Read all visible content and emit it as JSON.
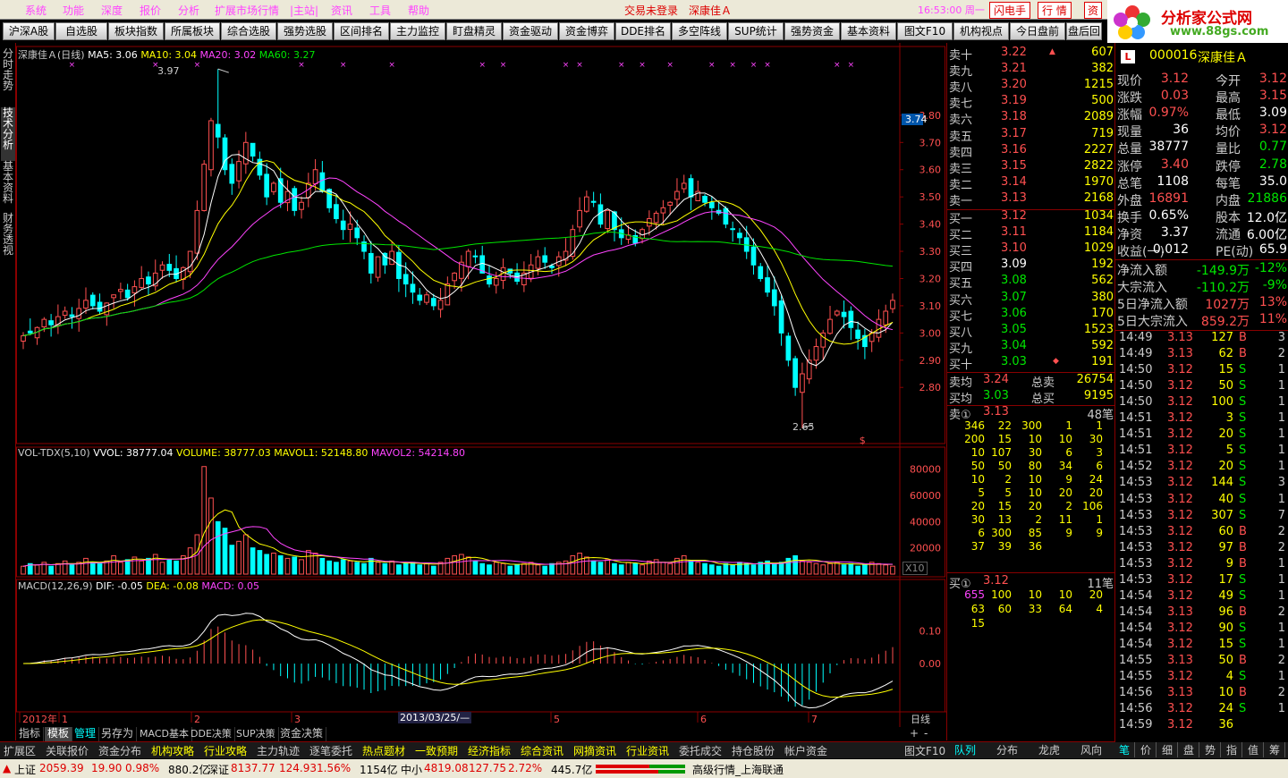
{
  "menu": {
    "items": [
      "系统",
      "功能",
      "深度",
      "报价",
      "分析",
      "扩展市场行情",
      "|主站|",
      "资讯",
      "工具",
      "帮助"
    ],
    "login_status": "交易未登录",
    "stock_title": "深康佳Ａ",
    "clock": "16:53:00 周一",
    "buttons": [
      "闪电手",
      "行 情",
      "资"
    ]
  },
  "logo": {
    "title": "分析家公式网",
    "url": "www.88gs.com"
  },
  "toolbar": [
    "沪深A股",
    "自选股",
    "板块指数",
    "所属板块",
    "综合选股",
    "强势选股",
    "区间排名",
    "主力监控",
    "盯盘精灵",
    "资金驱动",
    "资金博弈",
    "DDE排名",
    "多空阵线",
    "SUP统计",
    "强势资金",
    "基本资料",
    "图文F10",
    "机构视点",
    "今日盘前",
    "盘后回"
  ],
  "left_tabs": [
    "分时走势",
    "技术分析",
    "基本资料",
    "财务透视"
  ],
  "chart_legend": {
    "stock": "深康佳Ａ(日线)",
    "ma5": "MA5: 3.06",
    "ma10": "MA10: 3.04",
    "ma20": "MA20: 3.02",
    "ma60": "MA60: 3.27",
    "vol_title": "VOL-TDX(5,10)",
    "vvol": "VVOL: 38777.04",
    "volume": "VOLUME: 38777.03",
    "mavol1": "MAVOL1: 52148.80",
    "mavol2": "MAVOL2: 54214.80",
    "macd_title": "MACD(12,26,9)",
    "dif": "DIF: -0.05",
    "dea": "DEA: -0.08",
    "macd": "MACD: 0.05",
    "x10": "X10",
    "period": "日线",
    "high_label": "3.97",
    "low_label": "2.65",
    "current_price_tag": "3.74",
    "date_cursor": "2013/03/25/—"
  },
  "chart_data": [
    {
      "type": "candlestick",
      "title": "深康佳Ａ(日线)",
      "y_ticks": [
        2.8,
        2.9,
        3.0,
        3.1,
        3.2,
        3.3,
        3.4,
        3.5,
        3.6,
        3.7,
        3.8
      ],
      "ylim": [
        2.62,
        4.0
      ],
      "x_tick_labels": [
        "2012年",
        "1",
        "2",
        "3",
        "5",
        "6",
        "7"
      ],
      "highest": 3.97,
      "lowest": 2.65,
      "ma_lines": [
        {
          "name": "MA5",
          "color": "#ffffff"
        },
        {
          "name": "MA10",
          "color": "#ffff00"
        },
        {
          "name": "MA20",
          "color": "#ff44ff"
        },
        {
          "name": "MA60",
          "color": "#00e600"
        }
      ],
      "close_series": [
        2.99,
        3.0,
        3.02,
        3.05,
        3.03,
        3.06,
        3.08,
        3.06,
        3.09,
        3.12,
        3.1,
        3.08,
        3.11,
        3.14,
        3.16,
        3.13,
        3.17,
        3.2,
        3.18,
        3.22,
        3.25,
        3.23,
        3.2,
        3.24,
        3.3,
        3.45,
        3.62,
        3.78,
        3.72,
        3.6,
        3.55,
        3.63,
        3.7,
        3.65,
        3.58,
        3.5,
        3.55,
        3.48,
        3.52,
        3.45,
        3.48,
        3.55,
        3.6,
        3.52,
        3.46,
        3.42,
        3.38,
        3.4,
        3.35,
        3.3,
        3.22,
        3.28,
        3.25,
        3.3,
        3.2,
        3.18,
        3.15,
        3.12,
        3.14,
        3.1,
        3.12,
        3.18,
        3.22,
        3.26,
        3.3,
        3.28,
        3.22,
        3.18,
        3.2,
        3.24,
        3.22,
        3.19,
        3.22,
        3.25,
        3.28,
        3.26,
        3.24,
        3.28,
        3.3,
        3.38,
        3.45,
        3.5,
        3.48,
        3.4,
        3.45,
        3.38,
        3.35,
        3.36,
        3.33,
        3.38,
        3.42,
        3.44,
        3.46,
        3.48,
        3.52,
        3.55,
        3.5,
        3.52,
        3.48,
        3.46,
        3.44,
        3.4,
        3.38,
        3.35,
        3.3,
        3.25,
        3.2,
        3.15,
        3.1,
        3.0,
        2.9,
        2.8,
        2.85,
        2.9,
        2.95,
        3.0,
        3.05,
        3.08,
        3.06,
        3.02,
        2.98,
        2.95,
        3.0,
        3.05,
        3.08,
        3.12
      ],
      "volume_ticks": [
        20000,
        40000,
        60000,
        80000
      ],
      "volume_ylim": [
        0,
        90000
      ],
      "volume_series": [
        6000,
        8000,
        7000,
        9000,
        6000,
        8000,
        10000,
        7000,
        9000,
        12000,
        9000,
        8000,
        10000,
        14000,
        9000,
        11000,
        13000,
        10000,
        12000,
        15000,
        9000,
        11000,
        10000,
        14000,
        20000,
        30000,
        82000,
        58000,
        40000,
        35000,
        22000,
        25000,
        30000,
        20000,
        18000,
        15000,
        16000,
        14000,
        12000,
        13000,
        11000,
        18000,
        16000,
        12000,
        10000,
        9000,
        11000,
        10000,
        9000,
        8000,
        12000,
        9000,
        8000,
        10000,
        7000,
        8000,
        9000,
        7000,
        8000,
        6000,
        9000,
        12000,
        14000,
        15000,
        13000,
        10000,
        8000,
        7000,
        9000,
        8000,
        6000,
        7000,
        8000,
        9000,
        7000,
        6000,
        8000,
        9000,
        10000,
        14000,
        16000,
        13000,
        10000,
        9000,
        11000,
        8000,
        7000,
        9000,
        8000,
        7000,
        10000,
        11000,
        9000,
        8000,
        12000,
        14000,
        10000,
        9000,
        8000,
        7000,
        6000,
        8000,
        7000,
        9000,
        8000,
        7000,
        9000,
        10000,
        8000,
        9000,
        12000,
        14000,
        10000,
        9000,
        8000,
        7000,
        8000,
        9000,
        7000,
        8000,
        6000,
        7000,
        9000,
        8000,
        7000,
        6000
      ],
      "macd_ticks": [
        0.0,
        0.1
      ],
      "macd_ylim": [
        -0.14,
        0.22
      ]
    }
  ],
  "quote_panel": {
    "sell": [
      {
        "label": "卖十",
        "price": "3.22",
        "vol": "607"
      },
      {
        "label": "卖九",
        "price": "3.21",
        "vol": "382"
      },
      {
        "label": "卖八",
        "price": "3.20",
        "vol": "1215"
      },
      {
        "label": "卖七",
        "price": "3.19",
        "vol": "500"
      },
      {
        "label": "卖六",
        "price": "3.18",
        "vol": "2089"
      },
      {
        "label": "卖五",
        "price": "3.17",
        "vol": "719"
      },
      {
        "label": "卖四",
        "price": "3.16",
        "vol": "2227"
      },
      {
        "label": "卖三",
        "price": "3.15",
        "vol": "2822"
      },
      {
        "label": "卖二",
        "price": "3.14",
        "vol": "1970"
      },
      {
        "label": "卖一",
        "price": "3.13",
        "vol": "2168"
      }
    ],
    "buy": [
      {
        "label": "买一",
        "price": "3.12",
        "vol": "1034"
      },
      {
        "label": "买二",
        "price": "3.11",
        "vol": "1184"
      },
      {
        "label": "买三",
        "price": "3.10",
        "vol": "1029"
      },
      {
        "label": "买四",
        "price": "3.09",
        "vol": "192"
      },
      {
        "label": "买五",
        "price": "3.08",
        "vol": "562"
      },
      {
        "label": "买六",
        "price": "3.07",
        "vol": "380"
      },
      {
        "label": "买七",
        "price": "3.06",
        "vol": "170"
      },
      {
        "label": "买八",
        "price": "3.05",
        "vol": "1523"
      },
      {
        "label": "买九",
        "price": "3.04",
        "vol": "592"
      },
      {
        "label": "买十",
        "price": "3.03",
        "vol": "191"
      }
    ],
    "avg": [
      {
        "label": "卖均",
        "price": "3.24",
        "tl": "总卖",
        "tv": "26754"
      },
      {
        "label": "买均",
        "price": "3.03",
        "tl": "总买",
        "tv": "9195"
      }
    ],
    "sell1_queue": {
      "label": "卖①",
      "price": "3.13",
      "count": "48笔"
    },
    "sell_queue_rows": [
      [
        "346",
        "22",
        "300",
        "1",
        "1"
      ],
      [
        "200",
        "15",
        "10",
        "10",
        "30"
      ],
      [
        "10",
        "107",
        "30",
        "6",
        "3"
      ],
      [
        "50",
        "50",
        "80",
        "34",
        "6"
      ],
      [
        "10",
        "2",
        "10",
        "9",
        "24"
      ],
      [
        "5",
        "5",
        "10",
        "20",
        "20"
      ],
      [
        "20",
        "15",
        "20",
        "2",
        "106"
      ],
      [
        "30",
        "13",
        "2",
        "11",
        "1"
      ],
      [
        "6",
        "300",
        "85",
        "9",
        "9"
      ],
      [
        "37",
        "39",
        "36"
      ]
    ],
    "buy1_queue": {
      "label": "买①",
      "price": "3.12",
      "count": "11笔"
    },
    "buy_queue_rows": [
      [
        "655",
        "100",
        "10",
        "10",
        "20"
      ],
      [
        "63",
        "60",
        "33",
        "64",
        "4"
      ],
      [
        "15"
      ]
    ]
  },
  "right_panel": {
    "code": "000016",
    "name": "深康佳Ａ",
    "stats": [
      [
        "现价",
        "3.12",
        "今开",
        "3.12"
      ],
      [
        "涨跌",
        "0.03",
        "最高",
        "3.15"
      ],
      [
        "涨幅",
        "0.97%",
        "最低",
        "3.09"
      ],
      [
        "现量",
        "36",
        "均价",
        "3.12"
      ],
      [
        "总量",
        "38777",
        "量比",
        "0.77"
      ],
      [
        "涨停",
        "3.40",
        "跌停",
        "2.78"
      ],
      [
        "总笔",
        "1108",
        "每笔",
        "35.0"
      ],
      [
        "外盘",
        "16891",
        "内盘",
        "21886"
      ],
      [
        "换手",
        "0.65%",
        "股本",
        "12.0亿"
      ],
      [
        "净资",
        "3.37",
        "流通",
        "6.00亿"
      ],
      [
        "收益(一)",
        "0.012",
        "PE(动)",
        "65.9"
      ]
    ],
    "flows": [
      [
        "净流入额",
        "-149.9万",
        "-12%"
      ],
      [
        "大宗流入",
        "-110.2万",
        "-9%"
      ],
      [
        "5日净流入额",
        "1027万",
        "13%"
      ],
      [
        "5日大宗流入",
        "859.2万",
        "11%"
      ]
    ],
    "ticks": [
      [
        "14:49",
        "3.13",
        "127",
        "B",
        "3"
      ],
      [
        "14:49",
        "3.13",
        "62",
        "B",
        "2"
      ],
      [
        "14:50",
        "3.12",
        "15",
        "S",
        "1"
      ],
      [
        "14:50",
        "3.12",
        "50",
        "S",
        "1"
      ],
      [
        "14:50",
        "3.12",
        "100",
        "S",
        "1"
      ],
      [
        "14:51",
        "3.12",
        "3",
        "S",
        "1"
      ],
      [
        "14:51",
        "3.12",
        "20",
        "S",
        "1"
      ],
      [
        "14:51",
        "3.12",
        "5",
        "S",
        "1"
      ],
      [
        "14:52",
        "3.12",
        "20",
        "S",
        "1"
      ],
      [
        "14:53",
        "3.12",
        "144",
        "S",
        "3"
      ],
      [
        "14:53",
        "3.12",
        "40",
        "S",
        "1"
      ],
      [
        "14:53",
        "3.12",
        "307",
        "S",
        "7"
      ],
      [
        "14:53",
        "3.12",
        "60",
        "B",
        "2"
      ],
      [
        "14:53",
        "3.12",
        "97",
        "B",
        "2"
      ],
      [
        "14:53",
        "3.12",
        "9",
        "B",
        "1"
      ],
      [
        "14:53",
        "3.12",
        "17",
        "S",
        "1"
      ],
      [
        "14:54",
        "3.12",
        "49",
        "S",
        "1"
      ],
      [
        "14:54",
        "3.13",
        "96",
        "B",
        "2"
      ],
      [
        "14:54",
        "3.12",
        "90",
        "S",
        "1"
      ],
      [
        "14:54",
        "3.12",
        "15",
        "S",
        "1"
      ],
      [
        "14:55",
        "3.13",
        "50",
        "B",
        "2"
      ],
      [
        "14:55",
        "3.12",
        "4",
        "S",
        "1"
      ],
      [
        "14:56",
        "3.13",
        "10",
        "B",
        "2"
      ],
      [
        "14:56",
        "3.12",
        "24",
        "S",
        "1"
      ],
      [
        "14:59",
        "3.12",
        "36",
        "",
        ""
      ]
    ],
    "bottom_tabs": [
      "队列",
      "分布",
      "龙虎",
      "风向"
    ],
    "icon_tabs": [
      "笔",
      "价",
      "细",
      "盘",
      "势",
      "指",
      "值",
      "筹"
    ]
  },
  "bottom_tabs": [
    "指标",
    "模板",
    "管理",
    "另存为",
    "MACD基本",
    "DDE决策",
    "SUP决策",
    "资金决策"
  ],
  "func_bar": [
    "扩展区",
    "关联报价",
    "资金分布",
    "机构攻略",
    "行业攻略",
    "主力轨迹",
    "逐笔委托",
    "热点题材",
    "一致预期",
    "经济指标",
    "综合资讯",
    "网摘资讯",
    "行业资讯",
    "委托成交",
    "持仓股份",
    "帐户资金"
  ],
  "func_right": "图文F10",
  "status": {
    "sh_label": "上证",
    "sh_val": "2059.39",
    "sh_chg": "19.90",
    "sh_pct": "0.98%",
    "sh_amt": "880.2亿",
    "sz_label": "深证",
    "sz_val": "8137.77",
    "sz_chg": "124.93",
    "sz_pct": "1.56%",
    "sz_amt": "1154亿",
    "zx_label": "中小",
    "zx_val": "4819.08",
    "zx_chg": "127.75",
    "zx_pct": "2.72%",
    "zx_amt": "445.7亿",
    "market": "高级行情_上海联通"
  }
}
